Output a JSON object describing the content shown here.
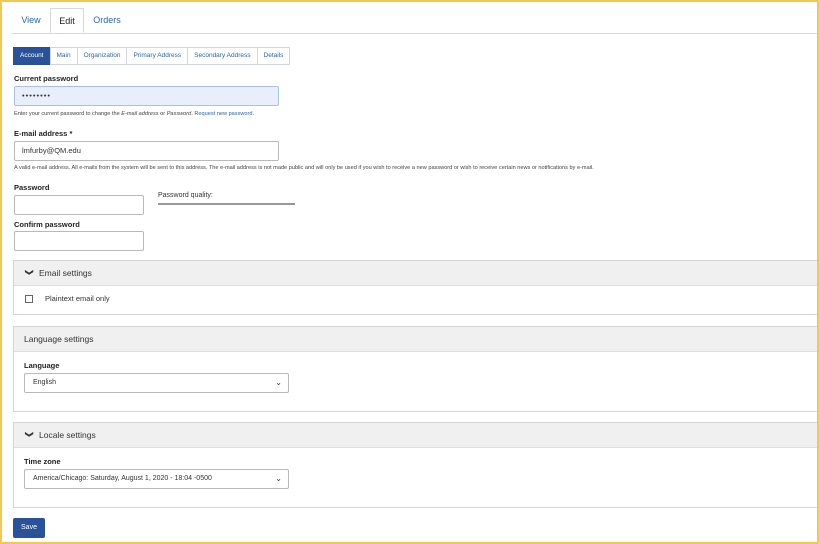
{
  "primary_tabs": [
    "View",
    "Edit",
    "Orders"
  ],
  "secondary_tabs": [
    "Account",
    "Main",
    "Organization",
    "Primary Address",
    "Secondary Address",
    "Details"
  ],
  "current_password": {
    "label": "Current password",
    "value": "••••••••",
    "help_prefix": "Enter your current password to change the ",
    "help_em1": "E-mail address",
    "help_mid": " or ",
    "help_em2": "Password",
    "help_sep": ". ",
    "help_link": "Request new password",
    "help_end": "."
  },
  "email": {
    "label": "E-mail address *",
    "value": "lmfurby@QM.edu",
    "help": "A valid e-mail address. All e-mails from the system will be sent to this address. The e-mail address is not made public and will only be used if you wish to receive a new password or wish to receive certain news or notifications by e-mail."
  },
  "password": {
    "label": "Password",
    "quality_label": "Password quality:"
  },
  "confirm_password": {
    "label": "Confirm password"
  },
  "email_settings": {
    "title": "Email settings",
    "checkbox_label": "Plaintext email only"
  },
  "language_settings": {
    "title": "Language settings",
    "language_label": "Language",
    "language_value": "English"
  },
  "locale_settings": {
    "title": "Locale settings",
    "timezone_label": "Time zone",
    "timezone_value": "America/Chicago: Saturday, August 1, 2020 - 18:04 -0500"
  },
  "save_label": "Save",
  "colors": {
    "accent": "#2a5298",
    "link": "#2a66b3",
    "frame": "#f2c94c"
  }
}
